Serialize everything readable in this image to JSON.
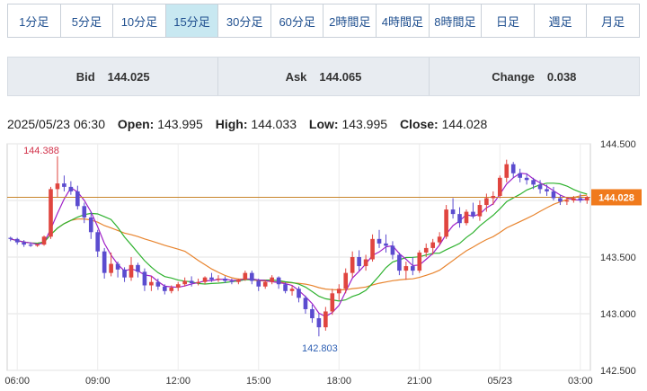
{
  "tabs": [
    {
      "label": "1分足",
      "active": false
    },
    {
      "label": "5分足",
      "active": false
    },
    {
      "label": "10分足",
      "active": false
    },
    {
      "label": "15分足",
      "active": true
    },
    {
      "label": "30分足",
      "active": false
    },
    {
      "label": "60分足",
      "active": false
    },
    {
      "label": "2時間足",
      "active": false
    },
    {
      "label": "4時間足",
      "active": false
    },
    {
      "label": "8時間足",
      "active": false
    },
    {
      "label": "日足",
      "active": false
    },
    {
      "label": "週足",
      "active": false
    },
    {
      "label": "月足",
      "active": false
    }
  ],
  "quote": {
    "bid_label": "Bid",
    "bid": "144.025",
    "ask_label": "Ask",
    "ask": "144.065",
    "change_label": "Change",
    "change": "0.038"
  },
  "ohlc": {
    "datetime": "2025/05/23 06:30",
    "open_label": "Open:",
    "open": "143.995",
    "high_label": "High:",
    "high": "144.033",
    "low_label": "Low:",
    "low": "143.995",
    "close_label": "Close:",
    "close": "144.028"
  },
  "colors": {
    "up": "#e0453f",
    "down": "#5b4ccf",
    "ma_fast": "#a020c8",
    "ma_mid": "#2fb22f",
    "ma_slow": "#e8842e",
    "price_line": "#c7852a",
    "price_tag": "#f07a1c"
  },
  "chart_data": {
    "type": "candlestick",
    "yticks": [
      "144.500",
      "144.000",
      "143.500",
      "143.000",
      "142.500"
    ],
    "ylim": [
      142.5,
      144.5
    ],
    "xticks": [
      {
        "label": "06:00",
        "i": 1
      },
      {
        "label": "09:00",
        "i": 13
      },
      {
        "label": "12:00",
        "i": 25
      },
      {
        "label": "15:00",
        "i": 37
      },
      {
        "label": "18:00",
        "i": 49
      },
      {
        "label": "21:00",
        "i": 61
      },
      {
        "label": "05/23",
        "i": 73
      },
      {
        "label": "03:00",
        "i": 85
      },
      {
        "label": "06:00",
        "i": 97
      }
    ],
    "high_annotation": {
      "label": "144.388",
      "i": 7,
      "value": 144.388
    },
    "low_annotation": {
      "label": "142.803",
      "i": 46,
      "value": 142.803
    },
    "current_price": {
      "label": "144.028",
      "value": 144.028
    },
    "candles": [
      [
        143.67,
        143.68,
        143.64,
        143.66
      ],
      [
        143.66,
        143.67,
        143.61,
        143.63
      ],
      [
        143.63,
        143.65,
        143.59,
        143.61
      ],
      [
        143.61,
        143.63,
        143.59,
        143.6
      ],
      [
        143.6,
        143.62,
        143.59,
        143.61
      ],
      [
        143.61,
        143.69,
        143.6,
        143.68
      ],
      [
        143.68,
        144.12,
        143.66,
        144.1
      ],
      [
        144.1,
        144.39,
        144.03,
        144.15
      ],
      [
        144.15,
        144.22,
        144.08,
        144.12
      ],
      [
        144.12,
        144.17,
        144.05,
        144.08
      ],
      [
        144.08,
        144.13,
        143.92,
        143.95
      ],
      [
        143.95,
        143.98,
        143.8,
        143.85
      ],
      [
        143.85,
        143.9,
        143.66,
        143.72
      ],
      [
        143.72,
        143.74,
        143.5,
        143.55
      ],
      [
        143.55,
        143.58,
        143.31,
        143.36
      ],
      [
        143.36,
        143.54,
        143.33,
        143.44
      ],
      [
        143.44,
        143.46,
        143.32,
        143.39
      ],
      [
        143.39,
        143.41,
        143.28,
        143.32
      ],
      [
        143.32,
        143.5,
        143.29,
        143.43
      ],
      [
        143.43,
        143.45,
        143.32,
        143.37
      ],
      [
        143.37,
        143.4,
        143.2,
        143.25
      ],
      [
        143.25,
        143.33,
        143.2,
        143.28
      ],
      [
        143.28,
        143.31,
        143.21,
        143.24
      ],
      [
        143.24,
        143.26,
        143.17,
        143.2
      ],
      [
        143.2,
        143.25,
        143.18,
        143.23
      ],
      [
        143.23,
        143.28,
        143.2,
        143.26
      ],
      [
        143.26,
        143.32,
        143.24,
        143.29
      ],
      [
        143.29,
        143.33,
        143.24,
        143.27
      ],
      [
        143.27,
        143.31,
        143.25,
        143.28
      ],
      [
        143.28,
        143.33,
        143.26,
        143.32
      ],
      [
        143.32,
        143.36,
        143.28,
        143.3
      ],
      [
        143.3,
        143.34,
        143.28,
        143.31
      ],
      [
        143.31,
        143.33,
        143.27,
        143.29
      ],
      [
        143.29,
        143.31,
        143.26,
        143.28
      ],
      [
        143.28,
        143.31,
        143.26,
        143.3
      ],
      [
        143.3,
        143.38,
        143.29,
        143.36
      ],
      [
        143.36,
        143.38,
        143.26,
        143.29
      ],
      [
        143.29,
        143.31,
        143.2,
        143.24
      ],
      [
        143.24,
        143.3,
        143.22,
        143.28
      ],
      [
        143.28,
        143.34,
        143.26,
        143.32
      ],
      [
        143.32,
        143.33,
        143.22,
        143.26
      ],
      [
        143.26,
        143.28,
        143.18,
        143.2
      ],
      [
        143.2,
        143.25,
        143.16,
        143.22
      ],
      [
        143.22,
        143.24,
        143.1,
        143.14
      ],
      [
        143.14,
        143.16,
        143.0,
        143.04
      ],
      [
        143.04,
        143.08,
        142.92,
        142.96
      ],
      [
        142.96,
        143.0,
        142.8,
        142.88
      ],
      [
        142.88,
        143.06,
        142.85,
        143.02
      ],
      [
        143.02,
        143.22,
        142.99,
        143.18
      ],
      [
        143.18,
        143.26,
        143.12,
        143.22
      ],
      [
        143.22,
        143.4,
        143.18,
        143.36
      ],
      [
        143.36,
        143.55,
        143.32,
        143.5
      ],
      [
        143.5,
        143.56,
        143.38,
        143.42
      ],
      [
        143.42,
        143.52,
        143.38,
        143.48
      ],
      [
        143.48,
        143.7,
        143.46,
        143.66
      ],
      [
        143.66,
        143.74,
        143.58,
        143.62
      ],
      [
        143.62,
        143.7,
        143.54,
        143.6
      ],
      [
        143.6,
        143.64,
        143.48,
        143.52
      ],
      [
        143.52,
        143.54,
        143.34,
        143.38
      ],
      [
        143.38,
        143.46,
        143.3,
        143.42
      ],
      [
        143.42,
        143.5,
        143.34,
        143.38
      ],
      [
        143.38,
        143.56,
        143.36,
        143.54
      ],
      [
        143.54,
        143.62,
        143.5,
        143.58
      ],
      [
        143.58,
        143.66,
        143.52,
        143.63
      ],
      [
        143.63,
        143.72,
        143.6,
        143.68
      ],
      [
        143.68,
        143.96,
        143.66,
        143.92
      ],
      [
        143.92,
        144.02,
        143.84,
        143.88
      ],
      [
        143.88,
        143.94,
        143.76,
        143.8
      ],
      [
        143.8,
        143.92,
        143.78,
        143.9
      ],
      [
        143.9,
        143.98,
        143.84,
        143.86
      ],
      [
        143.86,
        144.0,
        143.82,
        143.96
      ],
      [
        143.96,
        144.06,
        143.9,
        144.02
      ],
      [
        144.02,
        144.08,
        143.96,
        144.04
      ],
      [
        144.04,
        144.22,
        144.02,
        144.2
      ],
      [
        144.2,
        144.36,
        144.16,
        144.32
      ],
      [
        144.32,
        144.34,
        144.2,
        144.24
      ],
      [
        144.24,
        144.28,
        144.16,
        144.2
      ],
      [
        144.2,
        144.24,
        144.14,
        144.18
      ],
      [
        144.18,
        144.2,
        144.1,
        144.14
      ],
      [
        144.14,
        144.18,
        144.06,
        144.1
      ],
      [
        144.1,
        144.14,
        144.04,
        144.08
      ],
      [
        144.08,
        144.12,
        144.0,
        144.02
      ],
      [
        144.02,
        144.05,
        143.96,
        143.99
      ],
      [
        143.99,
        144.03,
        143.96,
        144.0
      ],
      [
        144.0,
        144.04,
        143.98,
        144.02
      ],
      [
        144.02,
        144.06,
        143.98,
        144.0
      ],
      [
        144.0,
        144.04,
        143.97,
        144.03
      ]
    ]
  }
}
